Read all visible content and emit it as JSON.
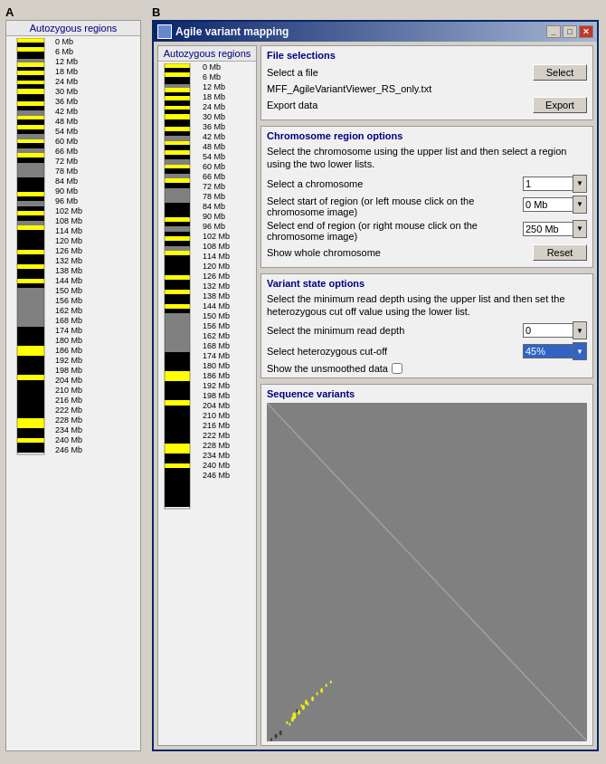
{
  "labels": {
    "a": "A",
    "b": "B"
  },
  "panel_a": {
    "title": "Autozygous regions",
    "mb_labels": [
      "0 Mb",
      "6 Mb",
      "12 Mb",
      "18 Mb",
      "24 Mb",
      "30 Mb",
      "36 Mb",
      "42 Mb",
      "48 Mb",
      "54 Mb",
      "60 Mb",
      "66 Mb",
      "72 Mb",
      "78 Mb",
      "84 Mb",
      "90 Mb",
      "96 Mb",
      "102 Mb",
      "108 Mb",
      "114 Mb",
      "120 Mb",
      "126 Mb",
      "132 Mb",
      "138 Mb",
      "144 Mb",
      "150 Mb",
      "156 Mb",
      "162 Mb",
      "168 Mb",
      "174 Mb",
      "180 Mb",
      "186 Mb",
      "192 Mb",
      "198 Mb",
      "204 Mb",
      "210 Mb",
      "216 Mb",
      "222 Mb",
      "228 Mb",
      "234 Mb",
      "240 Mb",
      "246 Mb"
    ]
  },
  "window": {
    "title": "Agile variant mapping",
    "btn_minimize": "_",
    "btn_maximize": "□",
    "btn_close": "✕"
  },
  "inner_chrom": {
    "title": "Autozygous regions",
    "mb_labels": [
      "0 Mb",
      "6 Mb",
      "12 Mb",
      "18 Mb",
      "24 Mb",
      "30 Mb",
      "36 Mb",
      "42 Mb",
      "48 Mb",
      "54 Mb",
      "60 Mb",
      "66 Mb",
      "72 Mb",
      "78 Mb",
      "84 Mb",
      "90 Mb",
      "96 Mb",
      "102 Mb",
      "108 Mb",
      "114 Mb",
      "120 Mb",
      "126 Mb",
      "132 Mb",
      "138 Mb",
      "144 Mb",
      "150 Mb",
      "156 Mb",
      "162 Mb",
      "168 Mb",
      "174 Mb",
      "180 Mb",
      "186 Mb",
      "192 Mb",
      "198 Mb",
      "204 Mb",
      "210 Mb",
      "216 Mb",
      "222 Mb",
      "228 Mb",
      "234 Mb",
      "240 Mb",
      "246 Mb"
    ]
  },
  "file_section": {
    "heading": "File selections",
    "select_file_label": "Select a file",
    "select_button": "Select",
    "filename": "MFF_AgileVariantViewer_RS_only.txt",
    "export_data_label": "Export data",
    "export_button": "Export"
  },
  "chrom_section": {
    "heading": "Chromosome region options",
    "description": "Select the chromosome using the upper list and then select a region using the two lower lists.",
    "select_chrom_label": "Select a chromosome",
    "chrom_value": "1",
    "start_label": "Select start of region (or left mouse click on the chromosome image)",
    "start_value": "0 Mb",
    "end_label": "Select end of region (or right mouse click on the chromosome image)",
    "end_value": "250 Mb",
    "whole_chrom_label": "Show whole chromosome",
    "reset_button": "Reset"
  },
  "variant_section": {
    "heading": "Variant state options",
    "description": "Select the minimum read depth using the upper list and then set the heterozygous cut off value using the lower list.",
    "min_depth_label": "Select the minimum read depth",
    "min_depth_value": "0",
    "hetero_label": "Select heterozygous cut-off",
    "hetero_value": "45%",
    "unsmoothed_label": "Show the unsmoothed data"
  },
  "sequence_section": {
    "heading": "Sequence variants"
  }
}
